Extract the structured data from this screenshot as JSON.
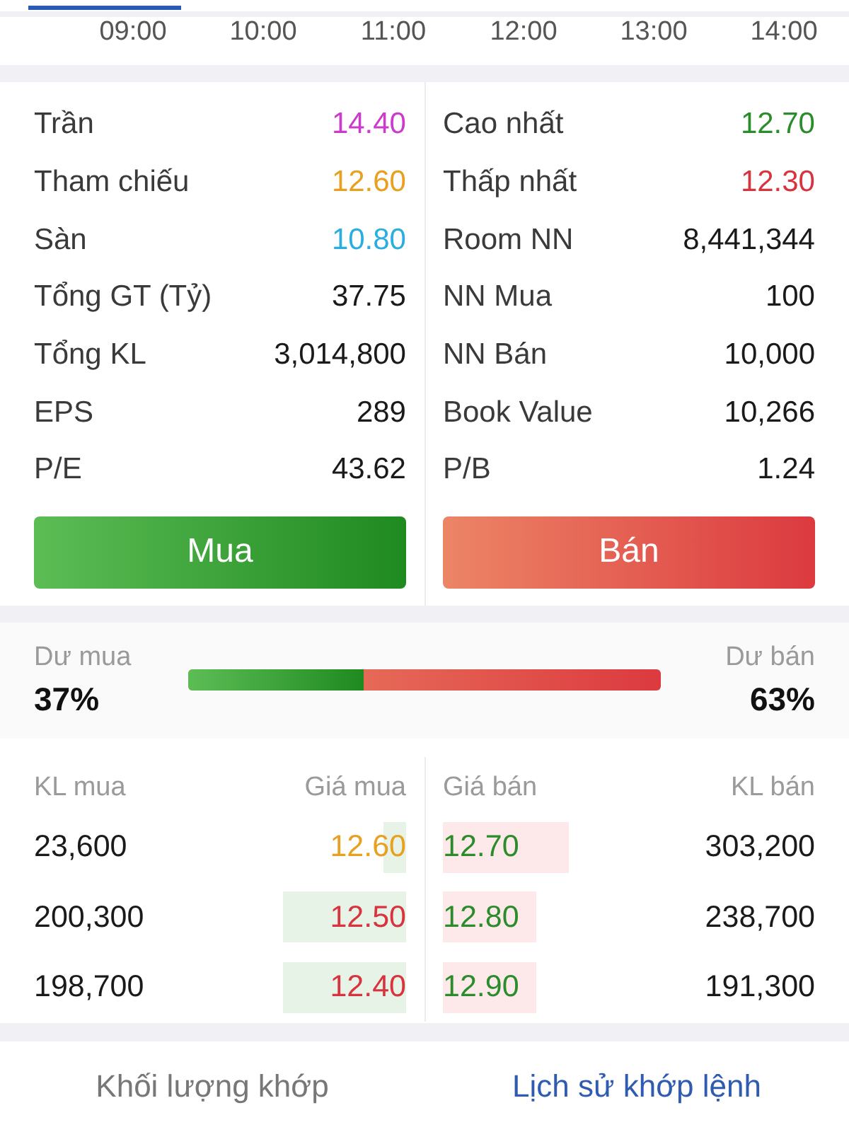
{
  "time_axis": {
    "labels": [
      "09:00",
      "10:00",
      "11:00",
      "12:00",
      "13:00",
      "14:00"
    ]
  },
  "stat_columns": [
    {
      "rows": [
        {
          "label": "Trần",
          "value": "14.40",
          "color": "#cc3ccc"
        },
        {
          "label": "Tham chiếu",
          "value": "12.60",
          "color": "#e7a020"
        },
        {
          "label": "Sàn",
          "value": "10.80",
          "color": "#2aaee0"
        },
        {
          "label": "Tổng GT (Tỷ)",
          "value": "37.75",
          "color": "#1a1a1a"
        },
        {
          "label": "Tổng KL",
          "value": "3,014,800",
          "color": "#1a1a1a"
        },
        {
          "label": "EPS",
          "value": "289",
          "color": "#1a1a1a"
        },
        {
          "label": "P/E",
          "value": "43.62",
          "color": "#1a1a1a"
        }
      ],
      "button": {
        "label": "Mua",
        "kind": "buy"
      }
    },
    {
      "rows": [
        {
          "label": "Cao nhất",
          "value": "12.70",
          "color": "#2a8c2a"
        },
        {
          "label": "Thấp nhất",
          "value": "12.30",
          "color": "#d8343f"
        },
        {
          "label": "Room NN",
          "value": "8,441,344",
          "color": "#1a1a1a"
        },
        {
          "label": "NN Mua",
          "value": "100",
          "color": "#1a1a1a"
        },
        {
          "label": "NN Bán",
          "value": "10,000",
          "color": "#1a1a1a"
        },
        {
          "label": "Book Value",
          "value": "10,266",
          "color": "#1a1a1a"
        },
        {
          "label": "P/B",
          "value": "1.24",
          "color": "#1a1a1a"
        }
      ],
      "button": {
        "label": "Bán",
        "kind": "sell"
      }
    }
  ],
  "balance": {
    "buy_label": "Dư mua",
    "buy_percent": "37%",
    "sell_label": "Dư bán",
    "sell_percent": "63%",
    "level": 0.37
  },
  "order_book": {
    "columns": [
      "KL mua",
      "Giá mua",
      "Giá bán",
      "KL bán"
    ],
    "rows": [
      {
        "buy": {
          "volume": "23,600",
          "price": "12.60",
          "color": "#e7a020",
          "level": 0.06
        },
        "sell": {
          "price": "12.70",
          "color": "#2a8c2a",
          "level": 0.34,
          "volume": "303,200"
        }
      },
      {
        "buy": {
          "volume": "200,300",
          "price": "12.50",
          "color": "#d8343f",
          "level": 0.33
        },
        "sell": {
          "price": "12.80",
          "color": "#2a8c2a",
          "level": 0.25,
          "volume": "238,700"
        }
      },
      {
        "buy": {
          "volume": "198,700",
          "price": "12.40",
          "color": "#d8343f",
          "level": 0.33
        },
        "sell": {
          "price": "12.90",
          "color": "#2a8c2a",
          "level": 0.25,
          "volume": "191,300"
        }
      }
    ]
  },
  "bottom_tabs": [
    {
      "label": "Khối lượng khớp",
      "selected": false
    },
    {
      "label": "Lịch sử khớp lệnh",
      "selected": true
    }
  ]
}
